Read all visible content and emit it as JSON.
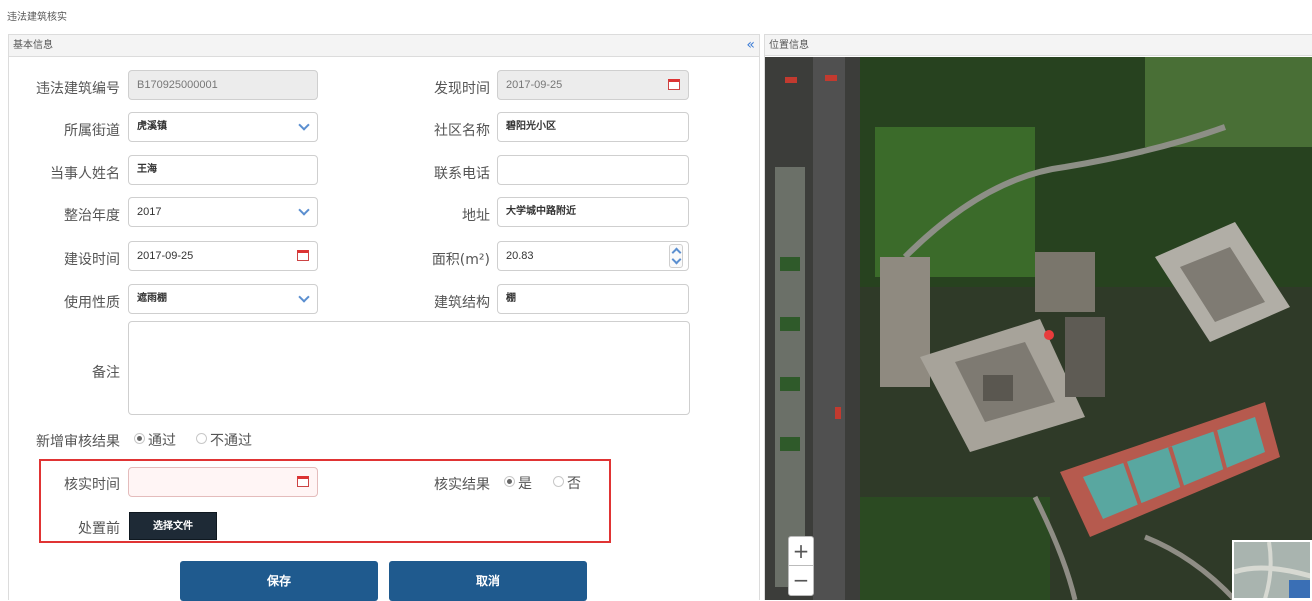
{
  "page": {
    "title": "违法建筑核实"
  },
  "basic_panel": {
    "title": "基本信息",
    "collapse_icon": "double-chevron-left-icon"
  },
  "location_panel": {
    "title": "位置信息"
  },
  "form": {
    "code": {
      "label": "违法建筑编号",
      "value": "B170925000001"
    },
    "found_time": {
      "label": "发现时间",
      "value": "2017-09-25"
    },
    "street": {
      "label": "所属街道",
      "value": "虎溪镇"
    },
    "community": {
      "label": "社区名称",
      "value": "碧阳光小区"
    },
    "party_name": {
      "label": "当事人姓名",
      "value": "王海"
    },
    "phone": {
      "label": "联系电话",
      "value": ""
    },
    "year": {
      "label": "整治年度",
      "value": "2017"
    },
    "address": {
      "label": "地址",
      "value": "大学城中路附近"
    },
    "build_time": {
      "label": "建设时间",
      "value": "2017-09-25"
    },
    "area": {
      "label": "面积(m²)",
      "value": "20.83"
    },
    "usage": {
      "label": "使用性质",
      "value": "遮雨棚"
    },
    "structure": {
      "label": "建筑结构",
      "value": "棚"
    },
    "remark": {
      "label": "备注",
      "value": ""
    },
    "review": {
      "label": "新增审核结果",
      "options": [
        "通过",
        "不通过"
      ],
      "selected": "通过"
    },
    "verify_time": {
      "label": "核实时间",
      "value": ""
    },
    "verify_result": {
      "label": "核实结果",
      "options": [
        "是",
        "否"
      ],
      "selected": "是"
    },
    "before": {
      "label": "处置前",
      "button": "选择文件"
    }
  },
  "actions": {
    "save": "保存",
    "cancel": "取消"
  },
  "map": {
    "zoom_in": "+",
    "zoom_out": "−"
  },
  "colors": {
    "primary_button": "#1f5a8e",
    "highlight_border": "#e03434",
    "file_button": "#1e2a36"
  }
}
